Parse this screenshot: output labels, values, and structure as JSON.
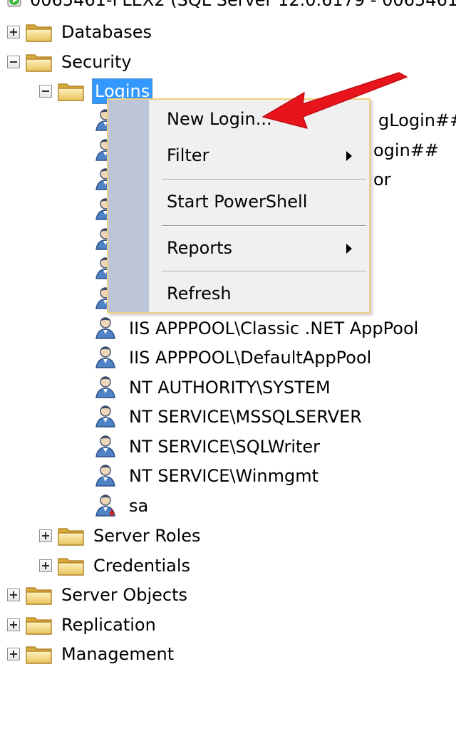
{
  "server_node": {
    "label": "0065461-FLEX2 (SQL Server 12.0.6179 - 0065461-F"
  },
  "tree": {
    "databases": "Databases",
    "security": "Security",
    "logins": "Logins",
    "login_partials": [
      "gLogin##",
      "ogin##",
      "or"
    ],
    "logins_list": [
      "IIS APPPOOL\\Classic .NET AppPool",
      "IIS APPPOOL\\DefaultAppPool",
      "NT AUTHORITY\\SYSTEM",
      "NT SERVICE\\MSSQLSERVER",
      "NT SERVICE\\SQLWriter",
      "NT SERVICE\\Winmgmt",
      "sa"
    ],
    "server_roles": "Server Roles",
    "credentials": "Credentials",
    "server_objects": "Server Objects",
    "replication": "Replication",
    "management": "Management"
  },
  "context_menu": {
    "items": [
      "New Login...",
      "Filter",
      "Start PowerShell",
      "Reports",
      "Refresh"
    ]
  },
  "colors": {
    "selection": "#3399ff",
    "menu_border": "#f2cf80",
    "menu_gutter": "#bcc6d8",
    "annotation_arrow": "#e8141b"
  },
  "icons": {
    "folder": "folder-icon",
    "login": "user-icon",
    "sa_login": "user-disabled-icon",
    "server": "server-icon",
    "expand": "plus-icon",
    "collapse": "minus-icon"
  }
}
